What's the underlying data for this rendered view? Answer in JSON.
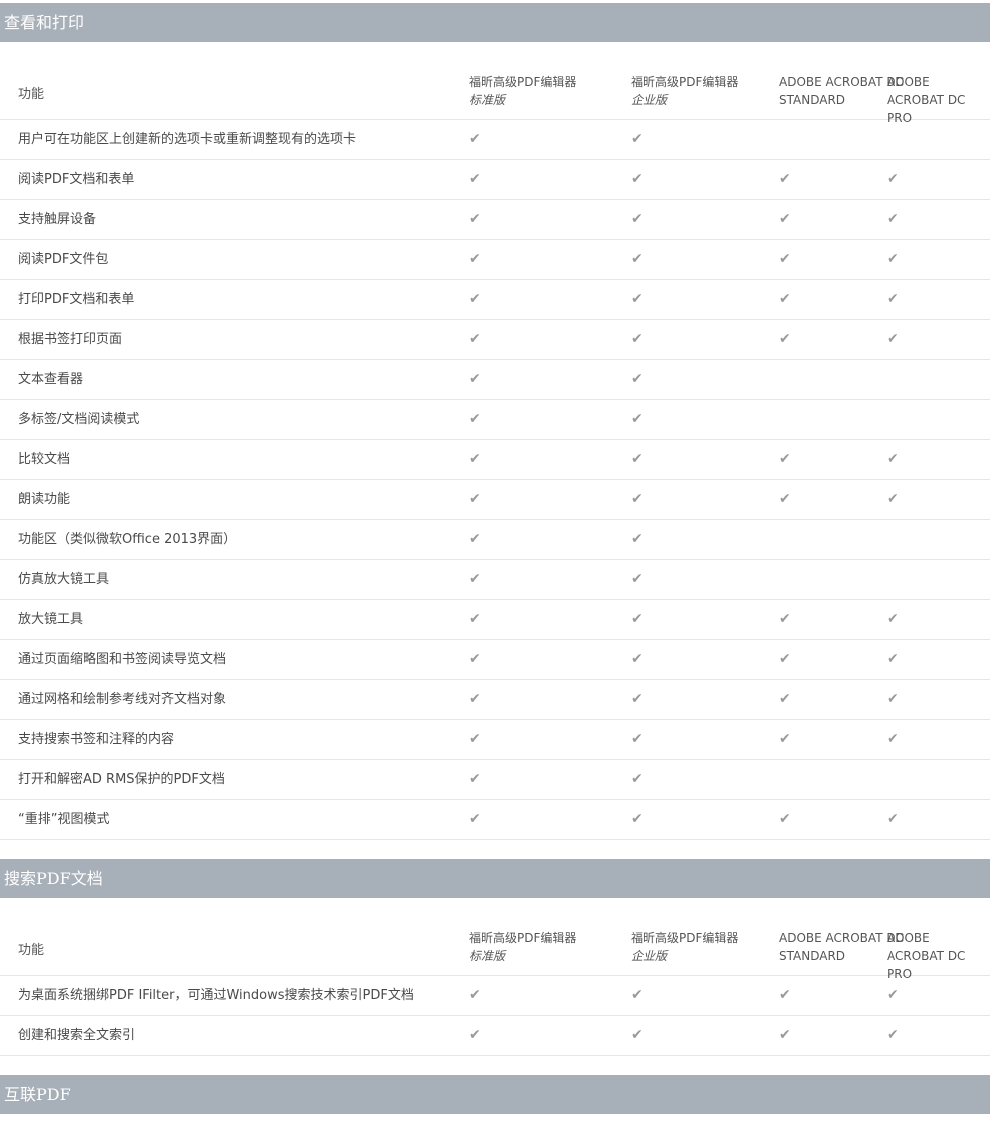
{
  "header_cols": {
    "feature": "功能",
    "col1": {
      "line1": "福昕高级PDF编辑器",
      "line2": "标准版"
    },
    "col2": {
      "line1": "福昕高级PDF编辑器",
      "line2": "企业版"
    },
    "col3": {
      "line1": "ADOBE ACROBAT DC",
      "line2": "STANDARD"
    },
    "col4": {
      "line1": "ADOBE ACROBAT DC",
      "line2": "PRO"
    }
  },
  "check_glyph": "✔",
  "colors": {
    "section_bg": "#a7afb8",
    "check": "#9a9a9a",
    "divider": "#e6e6e6"
  },
  "sections": [
    {
      "title": "查看和打印",
      "rows": [
        {
          "feature": "用户可在功能区上创建新的选项卡或重新调整现有的选项卡",
          "checks": [
            true,
            true,
            false,
            false
          ]
        },
        {
          "feature": "阅读PDF文档和表单",
          "checks": [
            true,
            true,
            true,
            true
          ]
        },
        {
          "feature": "支持触屏设备",
          "checks": [
            true,
            true,
            true,
            true
          ]
        },
        {
          "feature": "阅读PDF文件包",
          "checks": [
            true,
            true,
            true,
            true
          ]
        },
        {
          "feature": "打印PDF文档和表单",
          "checks": [
            true,
            true,
            true,
            true
          ]
        },
        {
          "feature": "根据书签打印页面",
          "checks": [
            true,
            true,
            true,
            true
          ]
        },
        {
          "feature": "文本查看器",
          "checks": [
            true,
            true,
            false,
            false
          ]
        },
        {
          "feature": "多标签/文档阅读模式",
          "checks": [
            true,
            true,
            false,
            false
          ]
        },
        {
          "feature": "比较文档",
          "checks": [
            true,
            true,
            true,
            true
          ]
        },
        {
          "feature": "朗读功能",
          "checks": [
            true,
            true,
            true,
            true
          ]
        },
        {
          "feature": "功能区（类似微软Office 2013界面）",
          "checks": [
            true,
            true,
            false,
            false
          ]
        },
        {
          "feature": "仿真放大镜工具",
          "checks": [
            true,
            true,
            false,
            false
          ]
        },
        {
          "feature": "放大镜工具",
          "checks": [
            true,
            true,
            true,
            true
          ]
        },
        {
          "feature": "通过页面缩略图和书签阅读导览文档",
          "checks": [
            true,
            true,
            true,
            true
          ]
        },
        {
          "feature": "通过网格和绘制参考线对齐文档对象",
          "checks": [
            true,
            true,
            true,
            true
          ]
        },
        {
          "feature": "支持搜索书签和注释的内容",
          "checks": [
            true,
            true,
            true,
            true
          ]
        },
        {
          "feature": "打开和解密AD RMS保护的PDF文档",
          "checks": [
            true,
            true,
            false,
            false
          ]
        },
        {
          "feature": "“重排”视图模式",
          "checks": [
            true,
            true,
            true,
            true
          ]
        }
      ]
    },
    {
      "title": "搜索PDF文档",
      "rows": [
        {
          "feature": "为桌面系统捆绑PDF IFilter，可通过Windows搜索技术索引PDF文档",
          "checks": [
            true,
            true,
            true,
            true
          ]
        },
        {
          "feature": "创建和搜索全文索引",
          "checks": [
            true,
            true,
            true,
            true
          ]
        }
      ]
    },
    {
      "title": "互联PDF",
      "rows": []
    }
  ]
}
